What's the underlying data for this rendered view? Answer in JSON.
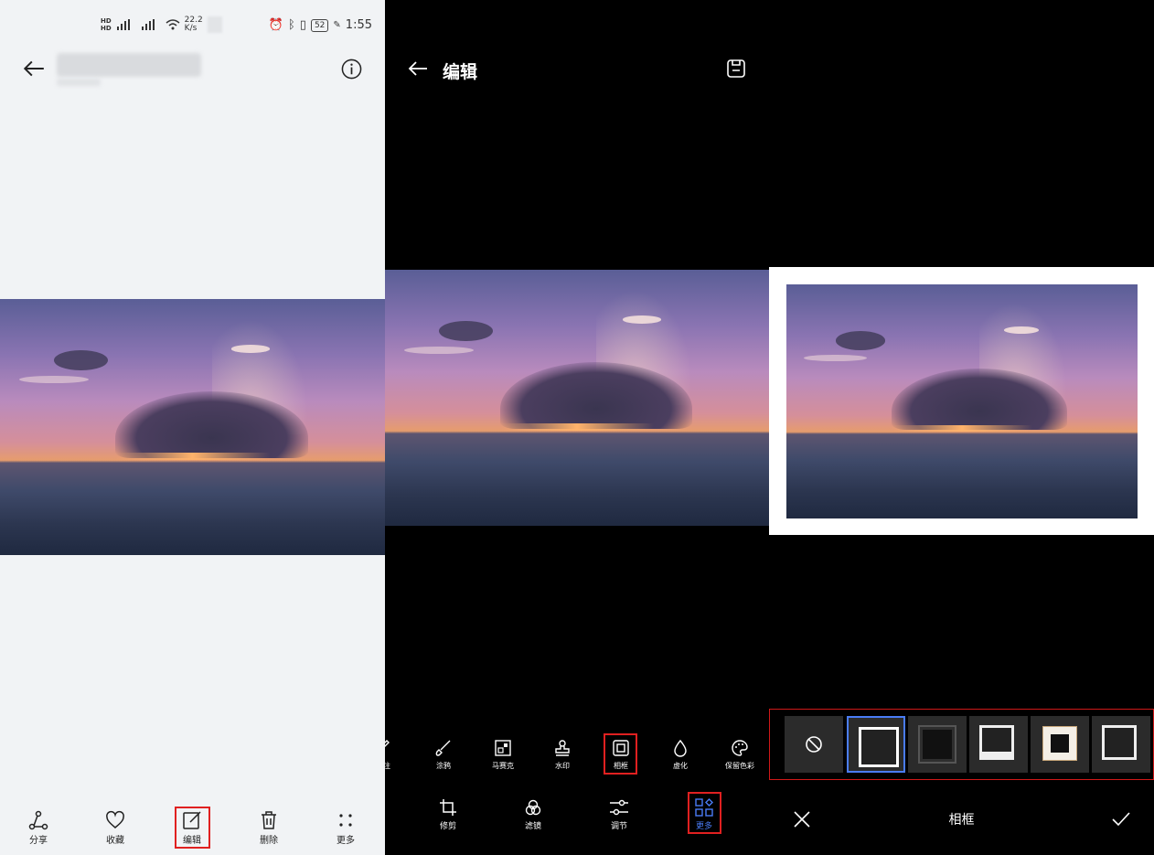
{
  "panel1": {
    "statusbar": {
      "net_speed": "22.2",
      "net_unit": "K/s",
      "battery": "52",
      "time": "1:55"
    },
    "bottom_bar": [
      {
        "label": "分享",
        "icon": "share-icon"
      },
      {
        "label": "收藏",
        "icon": "heart-icon"
      },
      {
        "label": "编辑",
        "icon": "edit-icon"
      },
      {
        "label": "删除",
        "icon": "trash-icon"
      },
      {
        "label": "更多",
        "icon": "more-dots-icon"
      }
    ]
  },
  "panel2": {
    "title": "编辑",
    "tools": [
      {
        "label": "注"
      },
      {
        "label": "涂鸦"
      },
      {
        "label": "马赛克"
      },
      {
        "label": "水印"
      },
      {
        "label": "相框"
      },
      {
        "label": "虚化"
      },
      {
        "label": "保留色彩"
      }
    ],
    "nav": [
      {
        "label": "修剪"
      },
      {
        "label": "滤镜"
      },
      {
        "label": "调节"
      },
      {
        "label": "更多"
      }
    ],
    "accent_color": "#4a7cf6"
  },
  "panel3": {
    "title": "相框",
    "frame_options": [
      "none-icon",
      "white-thick",
      "dark-inner",
      "white-bottom",
      "beige-mat",
      "white-border"
    ],
    "selected_index": 1,
    "highlight_color": "#e02020"
  }
}
